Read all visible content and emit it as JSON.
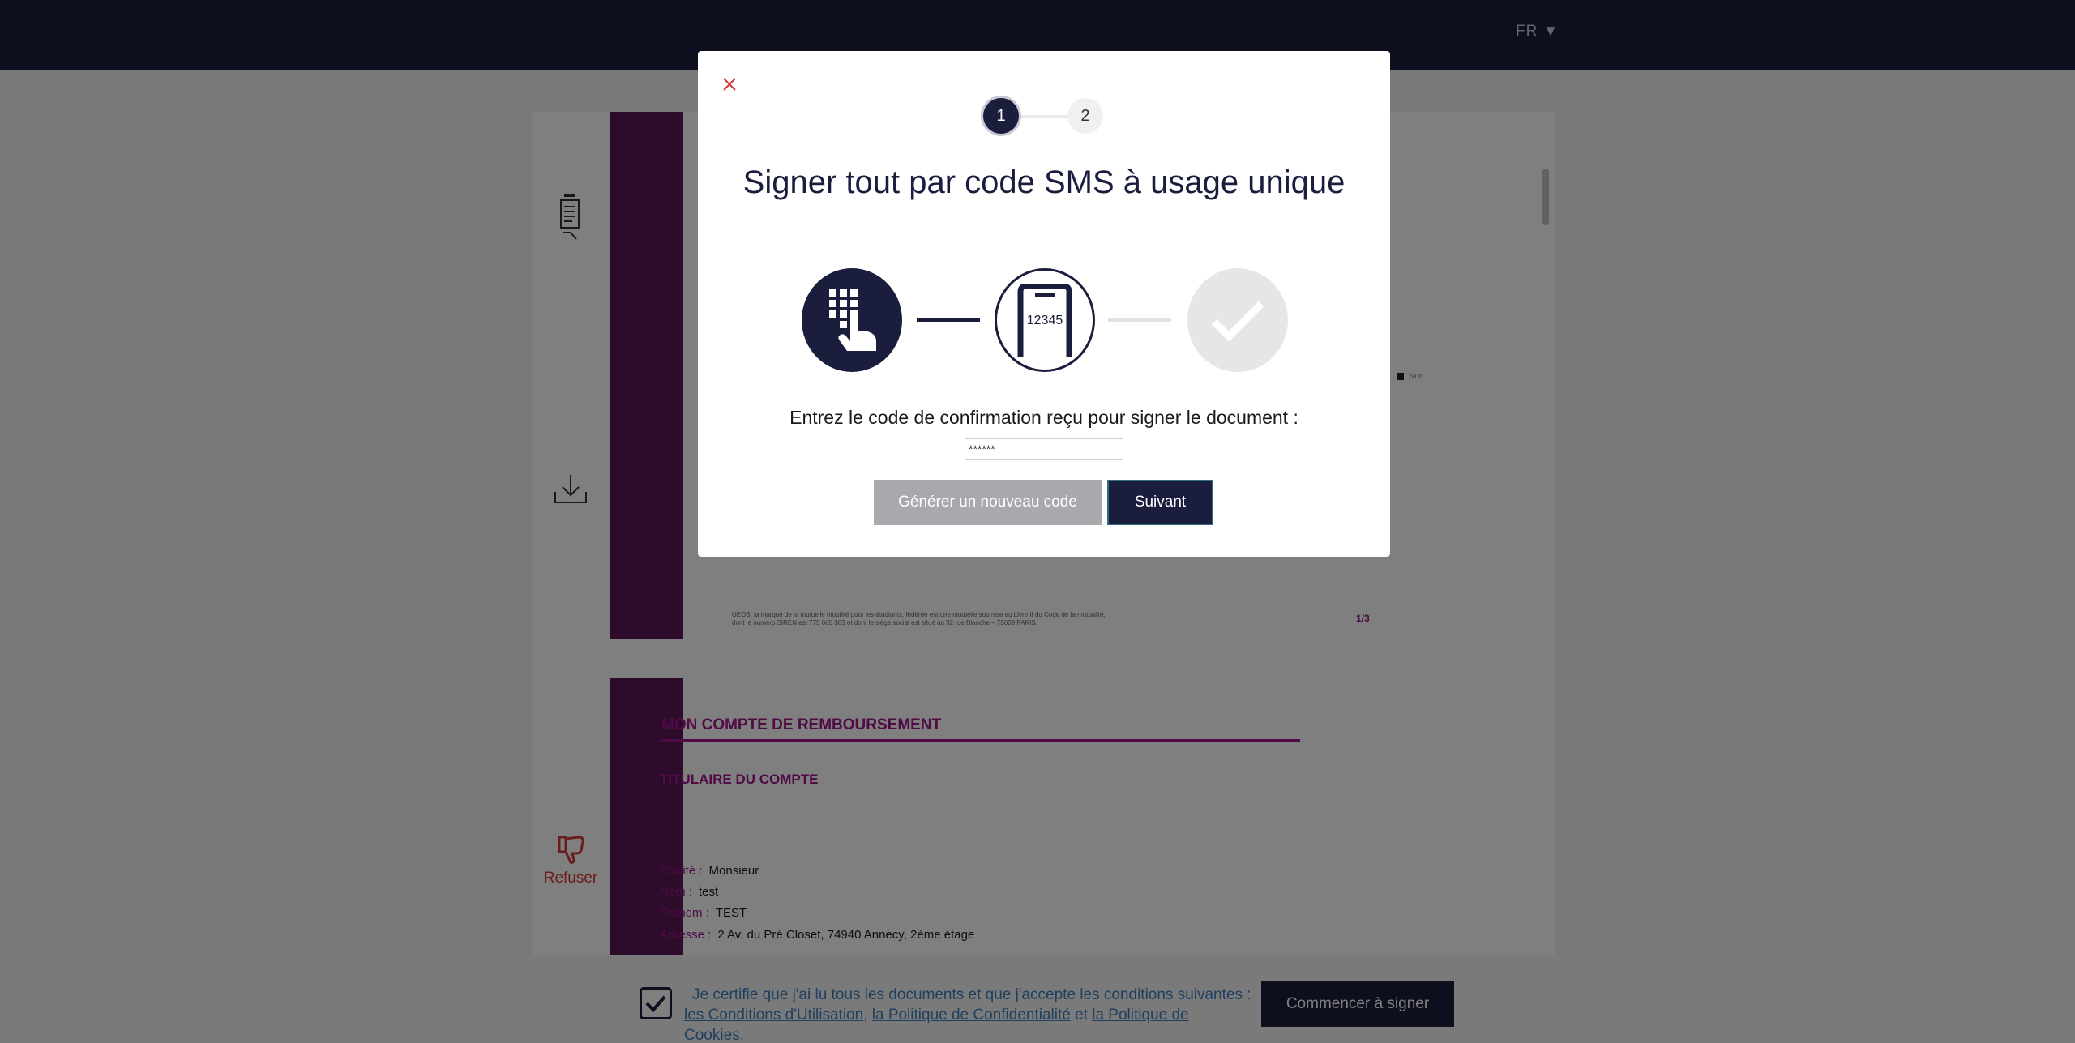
{
  "header": {
    "language": "FR ▼"
  },
  "document": {
    "page1": {
      "footer_line1": "UEOS, la marque de la mutuelle mobilité pour les étudiants, fédérée est une mutuelle soumise au Livre II du Code de la mutualité,",
      "footer_line2": "dont le numéro SIREN est 775 665 383 et dont le siège social est situé au 32 rue Blanche – 75009 PARIS.",
      "page_number": "1/3",
      "legend_label": "Non"
    },
    "page2": {
      "section_title": "MON COMPTE DE REMBOURSEMENT",
      "subsection_title": "TITULAIRE DU COMPTE",
      "fields": [
        {
          "label": "Civilité :",
          "value": "Monsieur"
        },
        {
          "label": "Nom :",
          "value": "test"
        },
        {
          "label": "Prénom :",
          "value": "TEST"
        },
        {
          "label": "Adresse :",
          "value": "2 Av. du Pré Closet, 74940 Annecy, 2ème étage"
        }
      ]
    }
  },
  "sidebar": {
    "refuse_label": "Refuser"
  },
  "certification": {
    "text_line1": "Je certifie que j'ai lu tous les documents et que j'accepte les conditions suivantes :",
    "link_terms": "les Conditions d'Utilisation",
    "link_privacy": "la Politique de Confidentialité",
    "conjunction": "et",
    "link_cookies": "la Politique de Cookies",
    "trailing": ".",
    "start_button": "Commencer à signer"
  },
  "modal": {
    "step1": "1",
    "step2": "2",
    "title": "Signer tout par code SMS à usage unique",
    "phone_code": "12345",
    "prompt": "Entrez le code de confirmation reçu pour signer le document :",
    "code_value": "******",
    "generate_button": "Générer un nouveau code",
    "next_button": "Suivant"
  },
  "colors": {
    "navy": "#1b1d3c",
    "purple_band": "#5a1654",
    "magenta": "#a0158d",
    "link_blue": "#3f7fbf",
    "refuse_red": "#d63838"
  }
}
